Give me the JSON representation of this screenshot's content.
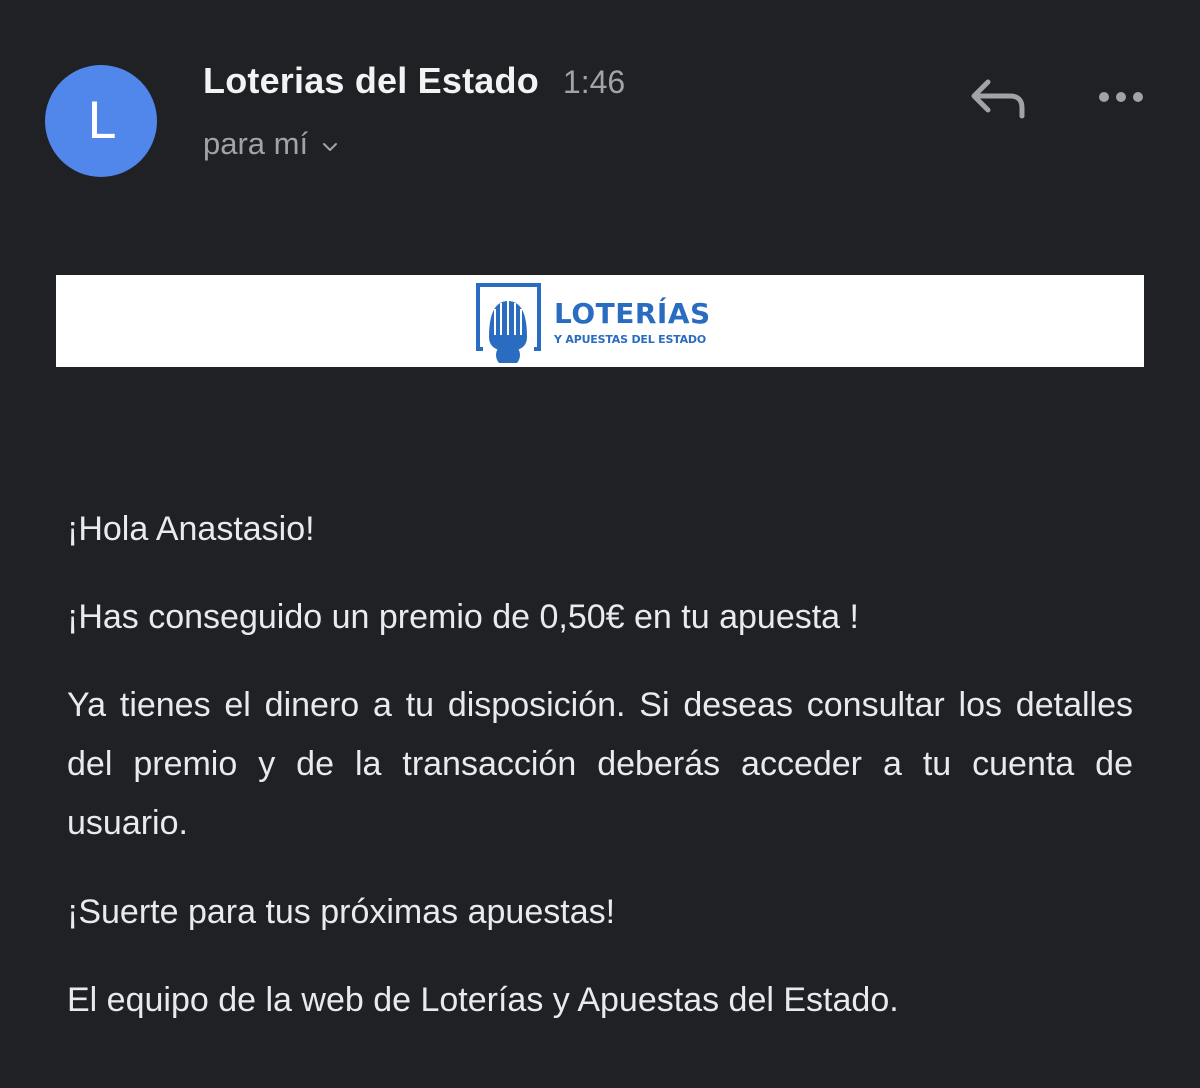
{
  "header": {
    "avatar_letter": "L",
    "avatar_color": "#5187ea",
    "sender_name": "Loterias del Estado",
    "time": "1:46",
    "recipient": "para mí",
    "actions": {
      "reply_icon": "reply-icon",
      "more_icon": "more-options-icon"
    }
  },
  "banner": {
    "logo_title": "LOTERÍAS",
    "logo_subtitle": "Y APUESTAS DEL ESTADO",
    "brand_color": "#2a6cc0"
  },
  "message": {
    "greeting": "¡Hola Anastasio!",
    "prize": "¡Has conseguido un premio de 0,50€ en tu apuesta !",
    "detail": "Ya tienes el dinero a tu disposición. Si deseas consultar los detalles del premio y de la transacción deberás acceder a tu cuenta de usuario.",
    "luck": "¡Suerte para tus próximas apuestas!",
    "signature": "El equipo de la web de Loterías y Apuestas del Estado."
  }
}
